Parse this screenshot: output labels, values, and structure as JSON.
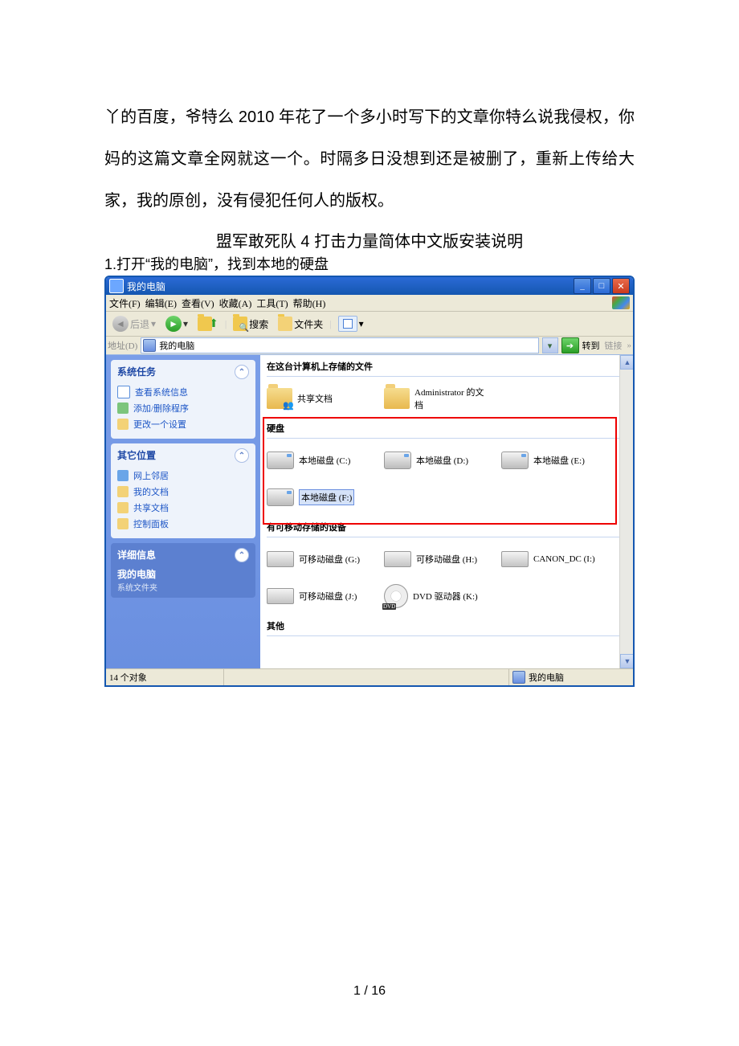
{
  "doc": {
    "paragraph": "丫的百度，爷特么 2010 年花了一个多小时写下的文章你特么说我侵权，你妈的这篇文章全网就这一个。时隔多日没想到还是被删了，重新上传给大家，我的原创，没有侵犯任何人的版权。",
    "subtitle": "盟军敢死队 4 打击力量简体中文版安装说明",
    "step1": "1.打开“我的电脑”，找到本地的硬盘"
  },
  "window": {
    "title": "我的电脑",
    "menus": [
      "文件(F)",
      "编辑(E)",
      "查看(V)",
      "收藏(A)",
      "工具(T)",
      "帮助(H)"
    ],
    "toolbar": {
      "back": "后退",
      "search": "搜索",
      "folders": "文件夹"
    },
    "addressbar": {
      "label": "地址(D)",
      "value": "我的电脑",
      "go": "转到",
      "links": "链接"
    }
  },
  "sidebar": {
    "tasks": {
      "title": "系统任务",
      "items": [
        "查看系统信息",
        "添加/删除程序",
        "更改一个设置"
      ]
    },
    "other": {
      "title": "其它位置",
      "items": [
        "网上邻居",
        "我的文档",
        "共享文档",
        "控制面板"
      ]
    },
    "detail": {
      "title": "详细信息",
      "line1": "我的电脑",
      "line2": "系统文件夹"
    }
  },
  "content": {
    "sec_files": "在这台计算机上存储的文件",
    "files": [
      {
        "label": "共享文档"
      },
      {
        "label": "Administrator 的文档"
      }
    ],
    "sec_disks": "硬盘",
    "disks": [
      {
        "label": "本地磁盘 (C:)"
      },
      {
        "label": "本地磁盘 (D:)"
      },
      {
        "label": "本地磁盘 (E:)"
      },
      {
        "label": "本地磁盘 (F:)",
        "hl": true
      }
    ],
    "sec_removable": "有可移动存储的设备",
    "removable": [
      {
        "label": "可移动磁盘 (G:)",
        "kind": "usb"
      },
      {
        "label": "可移动磁盘 (H:)",
        "kind": "usb"
      },
      {
        "label": "CANON_DC (I:)",
        "kind": "usb"
      },
      {
        "label": "可移动磁盘 (J:)",
        "kind": "usb"
      },
      {
        "label": "DVD 驱动器 (K:)",
        "kind": "dvd"
      }
    ],
    "sec_other": "其他"
  },
  "statusbar": {
    "left": "14 个对象",
    "right": "我的电脑"
  },
  "footer": "1 / 16"
}
